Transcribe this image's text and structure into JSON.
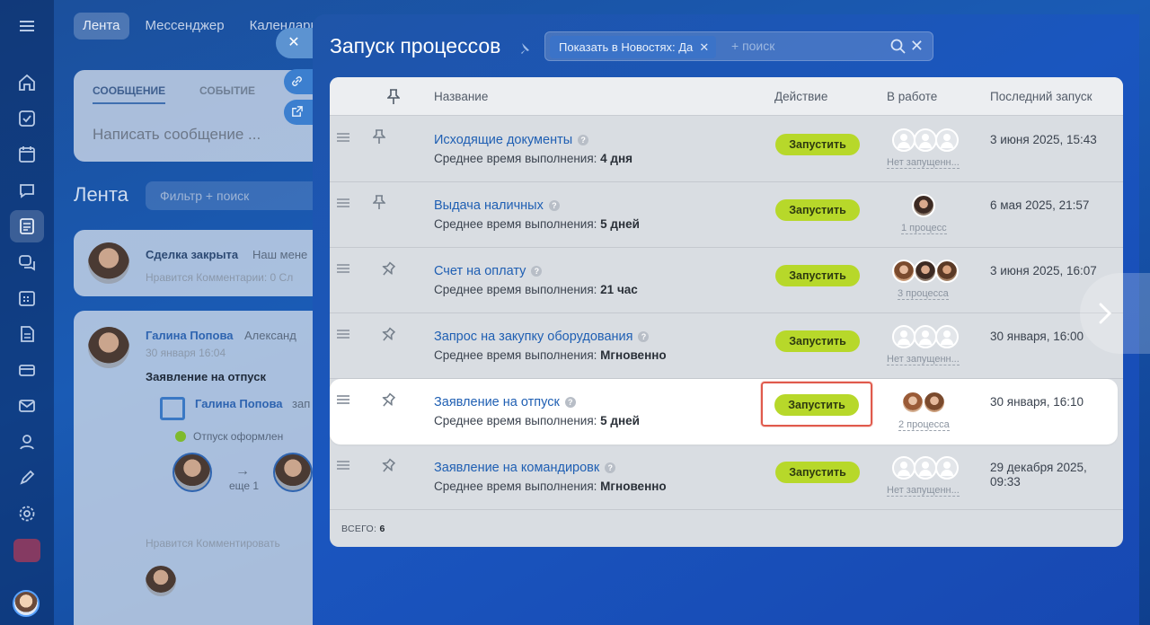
{
  "background": {
    "tabs": [
      "Лента",
      "Мессенджер",
      "Календарь"
    ],
    "post_tabs": [
      "СООБЩЕНИЕ",
      "СОБЫТИЕ"
    ],
    "post_placeholder": "Написать сообщение ...",
    "feed_title": "Лента",
    "feed_filter_placeholder": "Фильтр + поиск",
    "deal_title": "Сделка закрыта",
    "deal_text": "Наш мене",
    "deal_meta": "Нравится  Комментарии: 0  Сл",
    "news_author": "Галина Попова",
    "news_target": "Александ",
    "news_date": "30 января 16:04",
    "news_subject": "Заявление на отпуск",
    "news_inner_author": "Галина Попова",
    "news_inner_suffix": "зап",
    "news_status": "Отпуск оформлен",
    "news_more": "еще 1",
    "news_actions": "Нравится   Комментировать"
  },
  "slider": {
    "title": "Запуск процессов",
    "filter_chip": "Показать в Новостях: Да",
    "search_placeholder": "+ поиск"
  },
  "grid": {
    "columns": {
      "name": "Название",
      "action": "Действие",
      "in_work": "В работе",
      "last_run": "Последний запуск"
    },
    "sub_label": "Среднее время выполнения:",
    "run_label": "Запустить",
    "rows": [
      {
        "name": "Исходящие документы",
        "avg_time": "4 дня",
        "in_work": "Нет запущенн...",
        "last_run": "3 июня 2025, 15:43"
      },
      {
        "name": "Выдача наличных",
        "avg_time": "5 дней",
        "in_work": "1 процесс",
        "last_run": "6 мая 2025, 21:57"
      },
      {
        "name": "Счет на оплату",
        "avg_time": "21 час",
        "in_work": "3 процесса",
        "last_run": "3 июня 2025, 16:07"
      },
      {
        "name": "Запрос на закупку оборудования",
        "avg_time": "Мгновенно",
        "in_work": "Нет запущенн...",
        "last_run": "30 января, 16:00"
      },
      {
        "name": "Заявление на отпуск",
        "avg_time": "5 дней",
        "in_work": "2 процесса",
        "last_run": "30 января, 16:10"
      },
      {
        "name": "Заявление на командировк",
        "avg_time": "Мгновенно",
        "in_work": "Нет запущенн...",
        "last_run": "29 декабря 2025, 09:33"
      }
    ],
    "footer_label": "ВСЕГО:",
    "footer_total": "6"
  },
  "colors": {
    "run_button": "#b7d82a",
    "highlight_box": "#e05a4c",
    "link": "#1f5fb3"
  }
}
